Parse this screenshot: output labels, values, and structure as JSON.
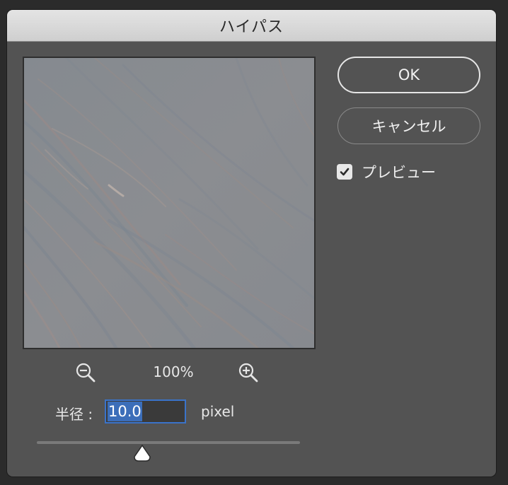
{
  "dialog": {
    "title": "ハイパス"
  },
  "preview_area": {
    "zoom_out_icon": "zoom-out-magnifier-icon",
    "zoom_in_icon": "zoom-in-magnifier-icon",
    "zoom_level": "100%"
  },
  "radius": {
    "label": "半径 :",
    "value": "10.0",
    "unit": "pixel",
    "slider_fraction": 0.4
  },
  "buttons": {
    "ok_label": "OK",
    "cancel_label": "キャンセル"
  },
  "preview_toggle": {
    "label": "プレビュー",
    "checked": true
  },
  "colors": {
    "dialog_bg": "#535353",
    "accent_blue": "#3a73c9",
    "text": "#e8e8e8"
  }
}
